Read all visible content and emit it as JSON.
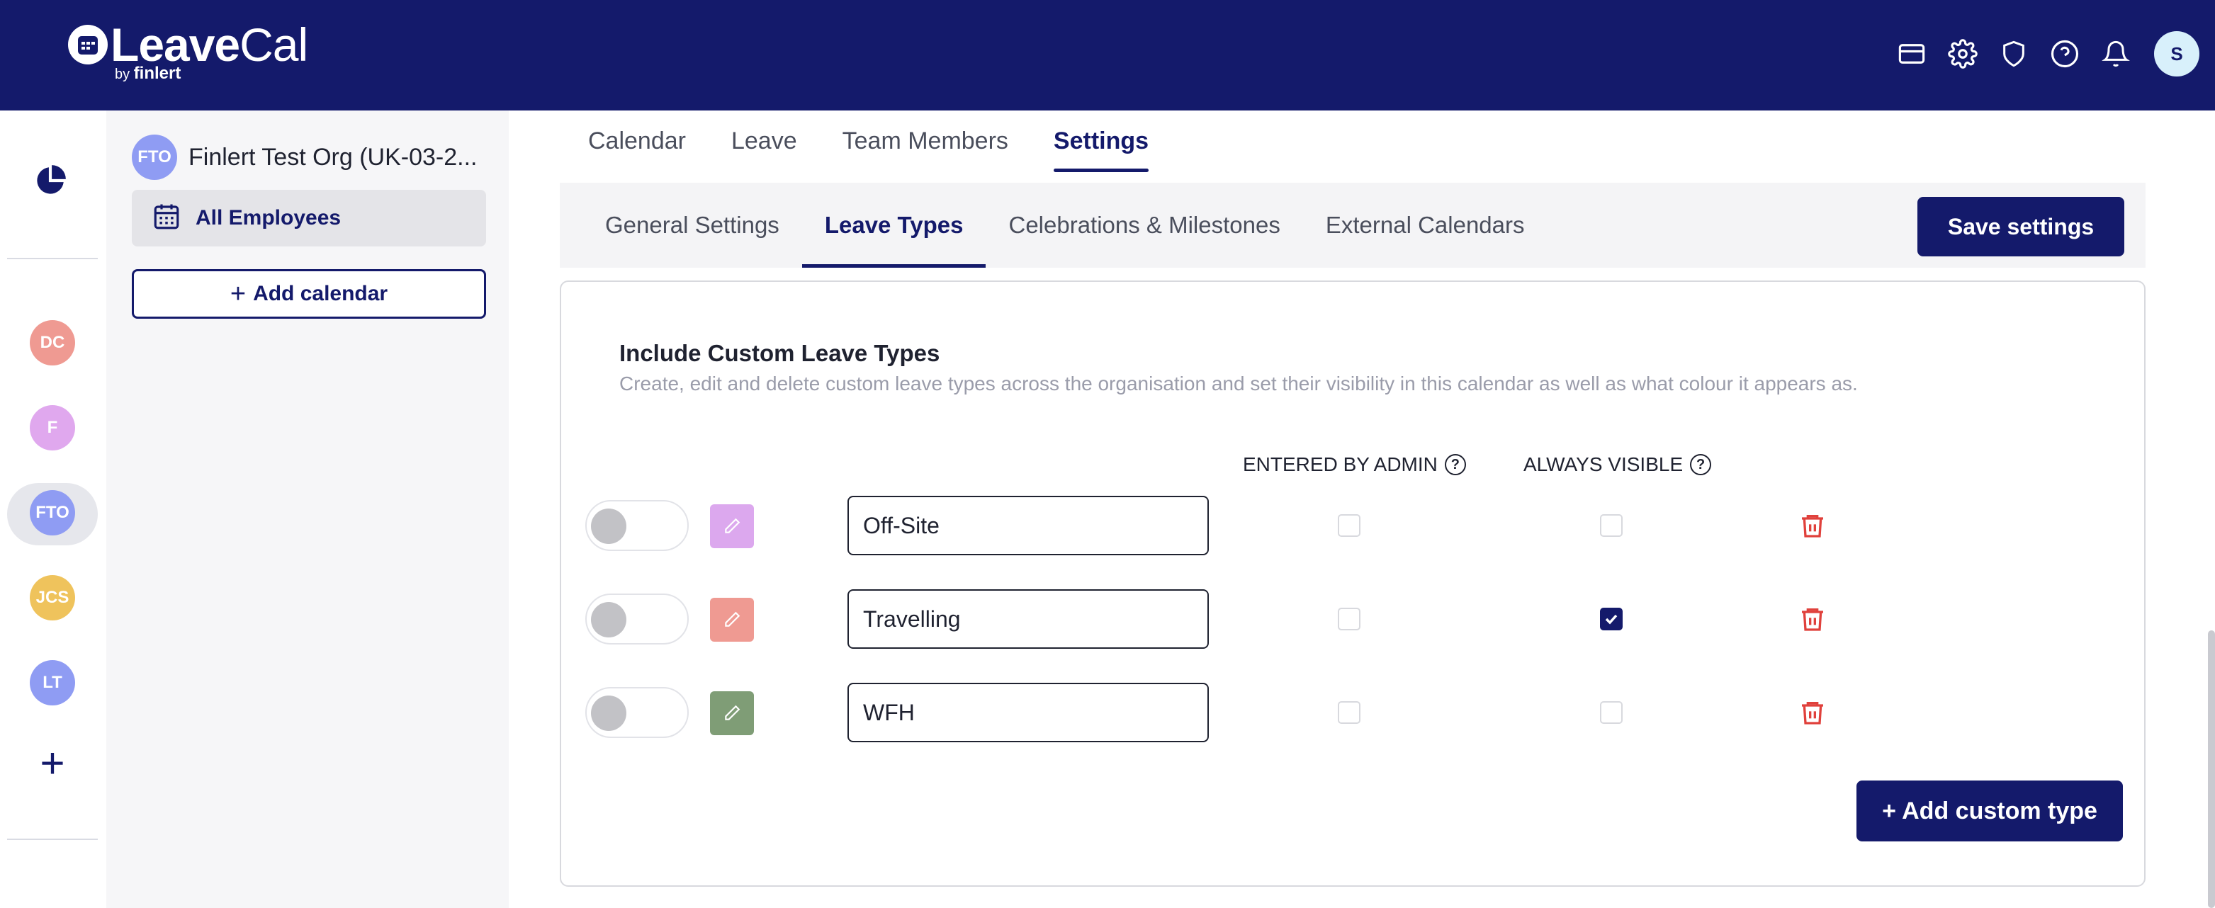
{
  "brand": {
    "name_light": "Leave",
    "name_bold": "Cal",
    "by": "by",
    "by_brand": "finlert"
  },
  "header": {
    "icons": [
      "billing-card-icon",
      "gear-icon",
      "shield-icon",
      "help-icon",
      "bell-icon"
    ],
    "user_initial": "S"
  },
  "rail": {
    "calendars": [
      {
        "initials": "DC",
        "color": "#ef9a92"
      },
      {
        "initials": "F",
        "color": "#e0a8ee"
      },
      {
        "initials": "FTO",
        "color": "#8f9cf3"
      },
      {
        "initials": "JCS",
        "color": "#efc35c"
      },
      {
        "initials": "LT",
        "color": "#8f9cf3"
      }
    ]
  },
  "org": {
    "initials": "FTO",
    "name": "Finlert Test Org (UK-03-2..."
  },
  "calendar_list": {
    "selected": "All Employees",
    "add_label": "Add calendar",
    "add_symbol": "+"
  },
  "main_tabs": [
    "Calendar",
    "Leave",
    "Team Members",
    "Settings"
  ],
  "sub_tabs": [
    "General Settings",
    "Leave Types",
    "Celebrations & Milestones",
    "External Calendars"
  ],
  "save_label": "Save settings",
  "section": {
    "title": "Include Custom Leave Types",
    "description": "Create, edit and delete custom leave types across the organisation and set their visibility in this calendar as well as what colour it appears as."
  },
  "columns": {
    "entered_by_admin": "ENTERED BY ADMIN",
    "always_visible": "ALWAYS VISIBLE",
    "help_glyph": "?"
  },
  "leave_types": [
    {
      "name": "Off-Site",
      "color": "#dca8ee",
      "enabled": false,
      "entered_by_admin": false,
      "always_visible": false
    },
    {
      "name": "Travelling",
      "color": "#ef9a92",
      "enabled": false,
      "entered_by_admin": false,
      "always_visible": true
    },
    {
      "name": "WFH",
      "color": "#7f9d76",
      "enabled": false,
      "entered_by_admin": false,
      "always_visible": false
    }
  ],
  "add_custom_label": "+ Add custom type",
  "colors": {
    "navy": "#141a6b",
    "danger": "#e0413c"
  }
}
